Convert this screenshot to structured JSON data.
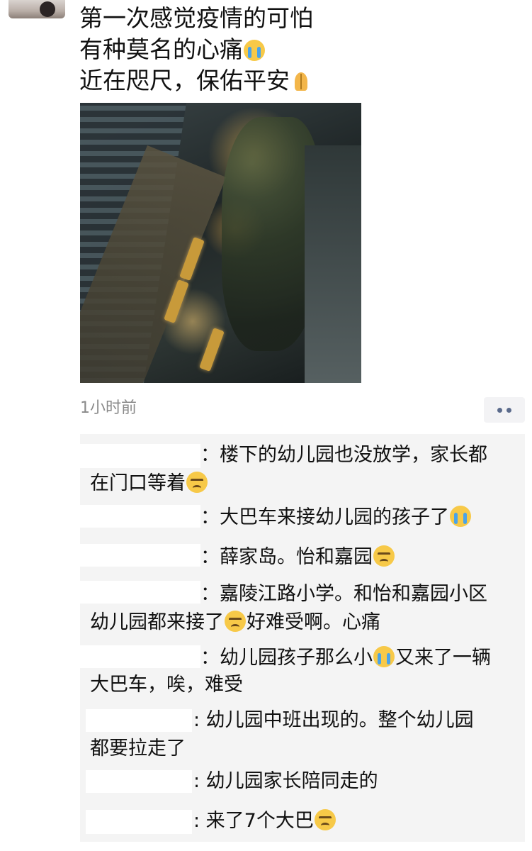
{
  "post": {
    "lines": [
      "第一次感觉疫情的可怕",
      "有种莫名的心痛",
      "近在咫尺，保佑平安"
    ],
    "emojis": [
      "crying-face",
      "praying-hands"
    ],
    "time": "1小时前"
  },
  "comments": [
    {
      "line1": "：楼下的幼儿园也没放学，家长都",
      "line2": "在门口等着",
      "emoji": "persevering-face"
    },
    {
      "line1": "：大巴车来接幼儿园的孩子了",
      "emoji": "crying-face"
    },
    {
      "line1": "：薛家岛。怡和嘉园",
      "emoji": "persevering-face"
    },
    {
      "line1": "：嘉陵江路小学。和怡和嘉园小区",
      "line2a": "幼儿园都来接了",
      "line2b": "好难受啊。心痛",
      "emoji": "persevering-face"
    },
    {
      "line1a": "：幼儿园孩子那么小",
      "line1b": "又来了一辆",
      "line2": "大巴车，唉，难受",
      "emoji": "crying-face"
    },
    {
      "line1": ": 幼儿园中班出现的。整个幼儿园",
      "line2": "都要拉走了"
    },
    {
      "line1": ": 幼儿园家长陪同走的"
    },
    {
      "line1": ": 来了7个大巴",
      "emoji": "persevering-face"
    }
  ],
  "colors": {
    "background": "#ffffff",
    "comment_area": "#f4f4f4",
    "time_text": "#8a8a8a",
    "more_dots": "#5b6b8c"
  }
}
